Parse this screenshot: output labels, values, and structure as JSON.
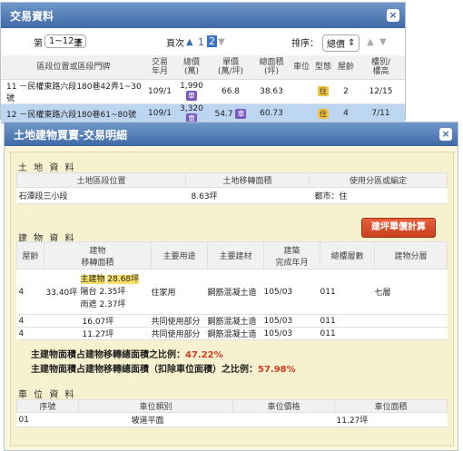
{
  "top": {
    "title": "交易資料",
    "close": "×",
    "pager": {
      "prefix": "第",
      "range": "1~12",
      "suffix": "筆",
      "page_label": "頁次",
      "page1": "1",
      "page2": "2",
      "sort_label": "排序：",
      "sort_value": "總價"
    },
    "headers": [
      "區段位置或區段門牌",
      "交易\n年月",
      "總價\n(萬)",
      "單價\n(萬/坪)",
      "總面積\n(坪)",
      "車位",
      "型態",
      "屋齡",
      "樓別/\n樓高"
    ],
    "rows": [
      {
        "no": "11",
        "addr": "－民權東路六段180巷42弄1~30號",
        "ym": "109/1",
        "total": "1,990",
        "car": "車",
        "unit": "66.8",
        "area": "38.63",
        "type": "住",
        "age": "2",
        "floor": "12/15"
      },
      {
        "no": "12",
        "addr": "－民權東路六段180巷61~80號",
        "ym": "109/1",
        "total": "3,320",
        "car": "車",
        "unit": "54.7",
        "car2": "車",
        "area": "60.73",
        "type": "住",
        "age": "4",
        "floor": "7/11"
      }
    ]
  },
  "detail": {
    "title": "土地建物買賣-交易明細",
    "close": "×",
    "land": {
      "section": "土 地 資 料",
      "headers": [
        "土地區段位置",
        "土地移轉面積",
        "使用分區或編定"
      ],
      "row": {
        "loc": "石潭段三小段",
        "area": "8.63坪",
        "zone": "都市：住"
      }
    },
    "building": {
      "section": "建 物 資 料",
      "calc_button": "建坪單價計算",
      "headers": [
        "屋齡",
        "建物\n移轉面積",
        "主要用途",
        "主要建材",
        "建築\n完成年月",
        "總樓層數",
        "建物分層"
      ],
      "row1": {
        "age": "4",
        "total": "33.40坪",
        "main_label": "主建物",
        "main_val": "28.68坪",
        "bal_label": "陽台",
        "bal_val": "2.35坪",
        "rain_label": "雨遮",
        "rain_val": "2.37坪",
        "use": "住家用",
        "mat": "鋼筋混凝土造",
        "date": "105/03",
        "floors": "011",
        "layer": "七層"
      },
      "row2": {
        "age": "4",
        "area": "16.07坪",
        "use": "共同使用部分",
        "mat": "鋼筋混凝土造",
        "date": "105/03",
        "floors": "011"
      },
      "row3": {
        "age": "4",
        "area": "11.27坪",
        "use": "共同使用部分",
        "mat": "鋼筋混凝土造",
        "date": "105/03",
        "floors": "011"
      },
      "ratio1_label": "主建物面積占建物移轉總面積之比例：",
      "ratio1_val": "47.22%",
      "ratio2_label": "主建物面積占建物移轉總面積（扣除車位面積）之比例：",
      "ratio2_val": "57.98%"
    },
    "parking": {
      "section": "車 位 資 料",
      "headers": [
        "序號",
        "車位類別",
        "車位價格",
        "車位面積"
      ],
      "row": {
        "no": "01",
        "type": "坡道平面",
        "price": "",
        "area": "11.27坪"
      }
    }
  }
}
